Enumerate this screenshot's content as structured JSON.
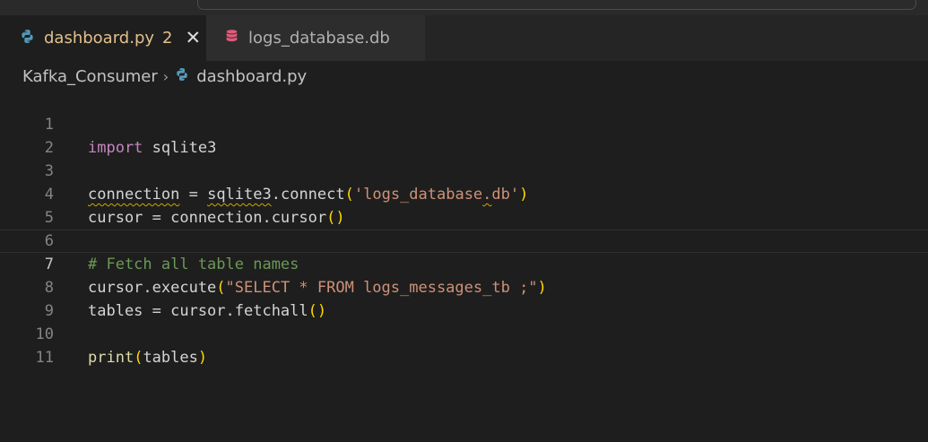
{
  "tabs": [
    {
      "label": "dashboard.py",
      "badge": "2",
      "icon": "python-icon",
      "close": "✕",
      "active": true,
      "color": "#e2c08d"
    },
    {
      "label": "logs_database.db",
      "icon": "database-icon",
      "active": false,
      "color": "#e05a7a"
    }
  ],
  "breadcrumb": {
    "folder": "Kafka_Consumer",
    "separator": "›",
    "file": "dashboard.py"
  },
  "editor": {
    "line_numbers": [
      "1",
      "2",
      "3",
      "4",
      "5",
      "6",
      "7",
      "8",
      "9",
      "10",
      "11"
    ],
    "code": {
      "l1": {
        "kw": "import",
        "rest": " sqlite3"
      },
      "l3": {
        "var": "connection",
        "eq": " = ",
        "mod": "sqlite3",
        "call": ".connect",
        "open": "(",
        "str_a": "'logs_database",
        "str_b": ".",
        "str_c": "db'",
        "close": ")"
      },
      "l4": {
        "pre": "cursor = connection.cursor",
        "open": "(",
        "close": ")"
      },
      "l6": {
        "comment": "# Fetch all table names"
      },
      "l7": {
        "pre": "cursor.execute",
        "open": "(",
        "str": "\"SELECT * FROM logs_messages_tb ;\"",
        "close": ")"
      },
      "l8": {
        "pre": "tables = cursor.fetchall",
        "open": "(",
        "close": ")"
      },
      "l10": {
        "fn": "print",
        "open": "(",
        "arg": "tables",
        "close": ")"
      }
    },
    "current_line": "7"
  },
  "colors": {
    "background": "#1e1e1e",
    "keyword": "#c586c0",
    "string": "#ce9178",
    "comment": "#6a9955",
    "bracket": "#ffd700",
    "warning_squiggle": "#cca700"
  }
}
